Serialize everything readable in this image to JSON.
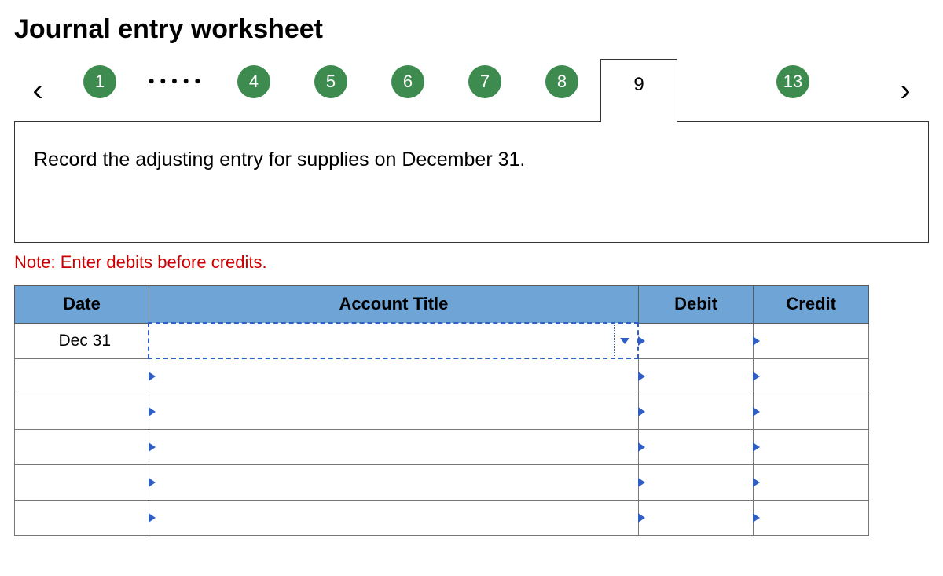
{
  "title": "Journal entry worksheet",
  "nav": {
    "prev_glyph": "‹",
    "next_glyph": "›",
    "ellipsis_glyph": "ꞏꞏꞏꞏꞏ",
    "steps": {
      "s1": "1",
      "s4": "4",
      "s5": "5",
      "s6": "6",
      "s7": "7",
      "s8": "8",
      "s9": "9",
      "s13": "13"
    },
    "active_step_key": "s9"
  },
  "instruction": "Record the adjusting entry for supplies on December 31.",
  "note": "Note: Enter debits before credits.",
  "table": {
    "headers": {
      "date": "Date",
      "account": "Account Title",
      "debit": "Debit",
      "credit": "Credit"
    },
    "rows": [
      {
        "date": "Dec 31",
        "account": "",
        "debit": "",
        "credit": ""
      },
      {
        "date": "",
        "account": "",
        "debit": "",
        "credit": ""
      },
      {
        "date": "",
        "account": "",
        "debit": "",
        "credit": ""
      },
      {
        "date": "",
        "account": "",
        "debit": "",
        "credit": ""
      },
      {
        "date": "",
        "account": "",
        "debit": "",
        "credit": ""
      },
      {
        "date": "",
        "account": "",
        "debit": "",
        "credit": ""
      }
    ]
  }
}
